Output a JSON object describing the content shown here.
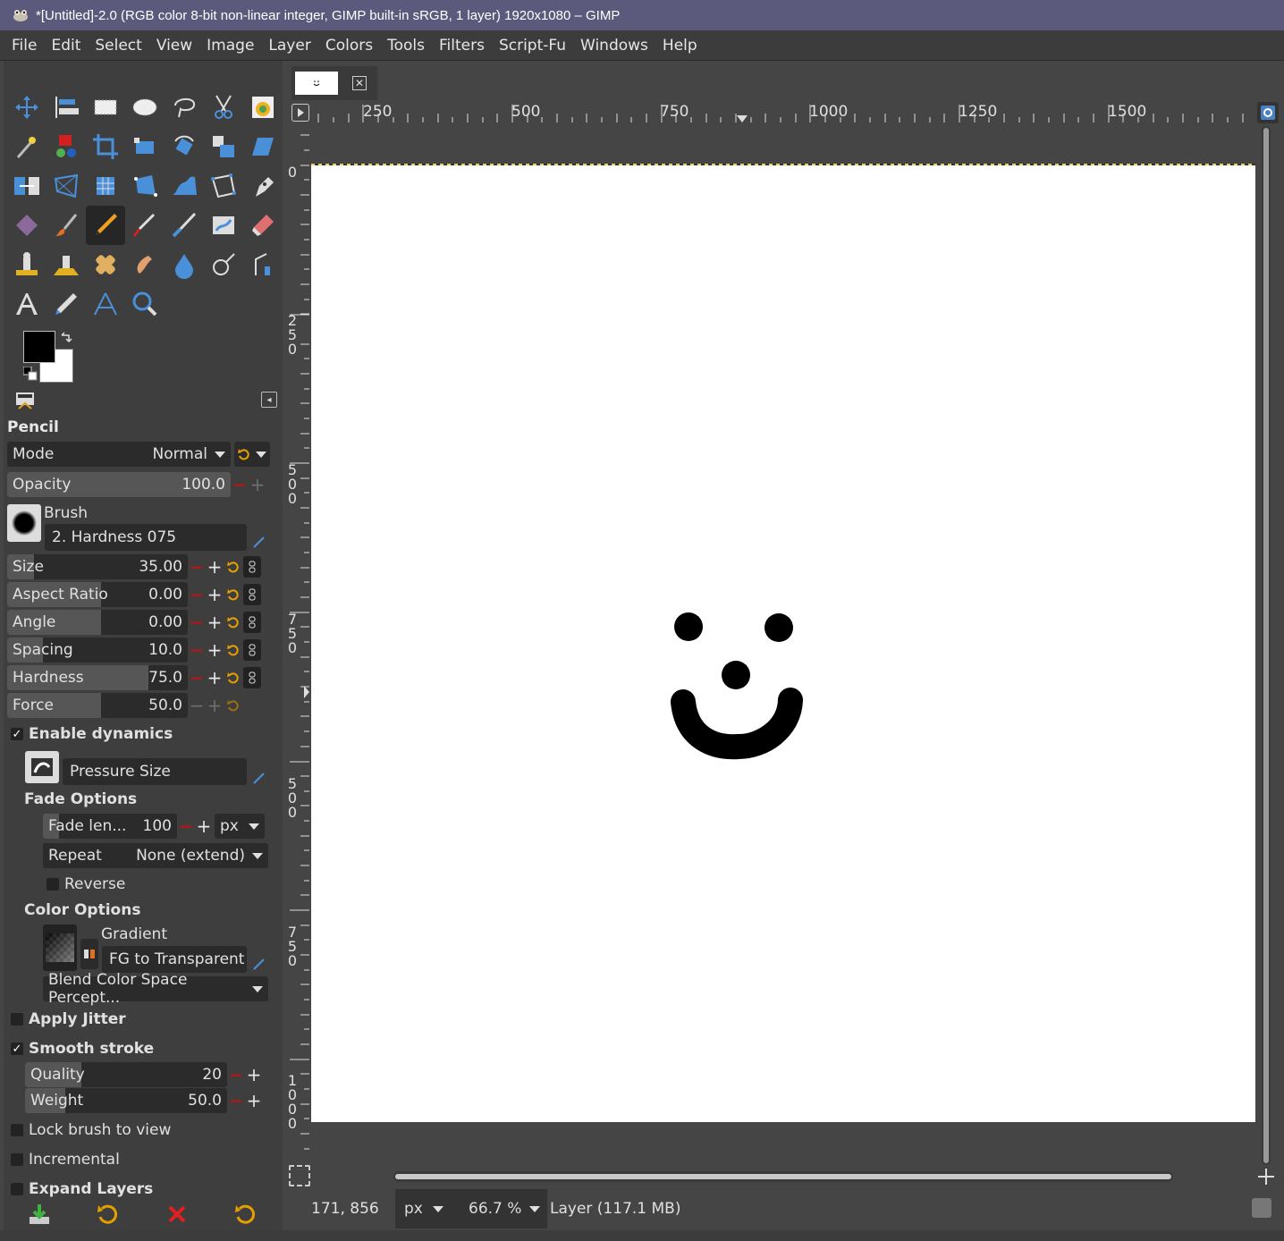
{
  "window": {
    "title": "*[Untitled]-2.0 (RGB color 8-bit non-linear integer, GIMP built-in sRGB, 1 layer) 1920x1080 – GIMP"
  },
  "menu": [
    "File",
    "Edit",
    "Select",
    "View",
    "Image",
    "Layer",
    "Colors",
    "Tools",
    "Filters",
    "Script-Fu",
    "Windows",
    "Help"
  ],
  "tools": [
    "move-icon",
    "align-icon",
    "rect-select-icon",
    "ellipse-select-icon",
    "free-select-icon",
    "scissors-icon",
    "foreground-select-icon",
    "fuzzy-select-icon",
    "by-color-select-icon",
    "crop-icon",
    "unified-transform-icon",
    "rotate-icon",
    "scale-icon",
    "shear-icon",
    "flip-icon",
    "perspective-icon",
    "3d-transform-icon",
    "handle-transform-icon",
    "warp-icon",
    "cage-icon",
    "paths-icon",
    "bucket-fill-icon",
    "paintbrush-icon",
    "pencil-icon",
    "airbrush-icon",
    "ink-icon",
    "mypaint-brush-icon",
    "eraser-icon",
    "clone-icon",
    "perspective-clone-icon",
    "heal-icon",
    "smudge-icon",
    "blur-icon",
    "dodge-burn-icon",
    "color-picker-tool-icon",
    "text-icon",
    "color-picker-icon",
    "measure-icon",
    "zoom-icon"
  ],
  "active_tool": "pencil-icon",
  "colors": {
    "foreground": "#000000",
    "background": "#ffffff",
    "accent_minus": "#b01818",
    "reset_icon": "#e5a000"
  },
  "tool_options": {
    "title": "Pencil",
    "mode": {
      "label": "Mode",
      "value": "Normal"
    },
    "opacity": {
      "label": "Opacity",
      "value": "100.0"
    },
    "brush": {
      "label": "Brush",
      "value": "2. Hardness 075"
    },
    "size": {
      "label": "Size",
      "value": "35.00",
      "fill": 0.15
    },
    "aspect_ratio": {
      "label": "Aspect Ratio",
      "value": "0.00",
      "fill": 0.5
    },
    "angle": {
      "label": "Angle",
      "value": "0.00",
      "fill": 0.5
    },
    "spacing": {
      "label": "Spacing",
      "value": "10.0",
      "fill": 0.18
    },
    "hardness": {
      "label": "Hardness",
      "value": "75.0",
      "fill": 0.75
    },
    "force": {
      "label": "Force",
      "value": "50.0",
      "fill": 0.5
    },
    "enable_dynamics": {
      "label": "Enable dynamics",
      "checked": true
    },
    "dynamics": {
      "value": "Pressure Size"
    },
    "fade_options": {
      "title": "Fade Options",
      "fade_length": {
        "label": "Fade len...",
        "value": "100",
        "unit": "px"
      },
      "repeat": {
        "label": "Repeat",
        "value": "None (extend)"
      },
      "reverse": {
        "label": "Reverse",
        "checked": false
      }
    },
    "color_options": {
      "title": "Color Options",
      "gradient_label": "Gradient",
      "gradient_value": "FG to Transparent",
      "blend_space": "Blend Color Space Percept..."
    },
    "apply_jitter": {
      "label": "Apply Jitter",
      "checked": false
    },
    "smooth_stroke": {
      "label": "Smooth stroke",
      "checked": true
    },
    "quality": {
      "label": "Quality",
      "value": "20",
      "fill": 0.2
    },
    "weight": {
      "label": "Weight",
      "value": "50.0",
      "fill": 0.15
    },
    "lock_brush": {
      "label": "Lock brush to view",
      "checked": false
    },
    "incremental": {
      "label": "Incremental",
      "checked": false
    },
    "expand_layers": {
      "label": "Expand Layers",
      "checked": false
    }
  },
  "rulers": {
    "horizontal": [
      "250",
      "500",
      "750",
      "1000",
      "1250",
      "1500"
    ],
    "vertical": [
      "0",
      "250",
      "500",
      "750",
      "500",
      "750",
      "1000"
    ]
  },
  "status": {
    "coords": "171, 856",
    "unit": "px",
    "zoom": "66.7 %",
    "layer_info": "Layer (117.1 MB)"
  }
}
